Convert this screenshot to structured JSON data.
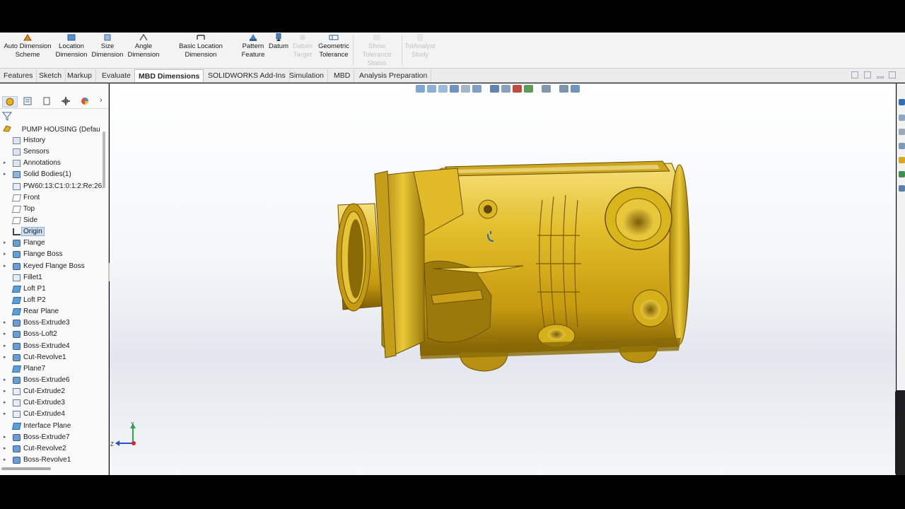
{
  "ribbon": {
    "buttons": [
      {
        "label": "Auto Dimension Scheme",
        "icon": "auto-dimension-icon",
        "enabled": true
      },
      {
        "label": "Location Dimension",
        "icon": "location-dimension-icon",
        "enabled": true
      },
      {
        "label": "Size Dimension",
        "icon": "size-dimension-icon",
        "enabled": true
      },
      {
        "label": "Angle Dimension",
        "icon": "angle-dimension-icon",
        "enabled": true
      },
      {
        "label": "Basic Location Dimension",
        "icon": "basic-location-dimension-icon",
        "enabled": true
      },
      {
        "label": "Pattern Feature",
        "icon": "pattern-feature-icon",
        "enabled": true
      },
      {
        "label": "Datum",
        "icon": "datum-icon",
        "enabled": true
      },
      {
        "label": "Datum Target",
        "icon": "datum-target-icon",
        "enabled": false
      },
      {
        "label": "Geometric Tolerance",
        "icon": "geometric-tolerance-icon",
        "enabled": true
      },
      {
        "label": "Show Tolerance Status",
        "icon": "tolerance-status-icon",
        "enabled": false
      },
      {
        "label": "TolAnalyst Study",
        "icon": "tolanalyst-icon",
        "enabled": false
      }
    ]
  },
  "tabs": [
    {
      "label": "Features",
      "active": false
    },
    {
      "label": "Sketch",
      "active": false
    },
    {
      "label": "Markup",
      "active": false
    },
    {
      "label": "Evaluate",
      "active": false
    },
    {
      "label": "MBD Dimensions",
      "active": true
    },
    {
      "label": "SOLIDWORKS Add-Ins",
      "active": false
    },
    {
      "label": "Simulation",
      "active": false
    },
    {
      "label": "MBD",
      "active": false
    },
    {
      "label": "Analysis Preparation",
      "active": false
    }
  ],
  "feature_tree": {
    "root": "PUMP HOUSING (Defau",
    "items": [
      {
        "label": "History",
        "icon": "folder",
        "expandable": false
      },
      {
        "label": "Sensors",
        "icon": "folder",
        "expandable": false
      },
      {
        "label": "Annotations",
        "icon": "folder",
        "expandable": true
      },
      {
        "label": "Solid Bodies(1)",
        "icon": "body",
        "expandable": true
      },
      {
        "label": "PW60:13:C1:0:1:2:Re:26:",
        "icon": "cut",
        "expandable": false
      },
      {
        "label": "Front",
        "icon": "plane-outline",
        "expandable": false
      },
      {
        "label": "Top",
        "icon": "plane-outline",
        "expandable": false
      },
      {
        "label": "Side",
        "icon": "plane-outline",
        "expandable": false
      },
      {
        "label": "Origin",
        "icon": "origin",
        "expandable": false,
        "selected": true
      },
      {
        "label": "Flange",
        "icon": "feature",
        "expandable": true
      },
      {
        "label": "Flange Boss",
        "icon": "feature",
        "expandable": true
      },
      {
        "label": "Keyed Flange Boss",
        "icon": "feature",
        "expandable": true
      },
      {
        "label": "Fillet1",
        "icon": "cut",
        "expandable": false
      },
      {
        "label": "Loft P1",
        "icon": "plane",
        "expandable": false
      },
      {
        "label": "Loft P2",
        "icon": "plane",
        "expandable": false
      },
      {
        "label": "Rear Plane",
        "icon": "plane",
        "expandable": false
      },
      {
        "label": "Boss-Extrude3",
        "icon": "feature",
        "expandable": true
      },
      {
        "label": "Boss-Loft2",
        "icon": "feature",
        "expandable": true
      },
      {
        "label": "Boss-Extrude4",
        "icon": "feature",
        "expandable": true
      },
      {
        "label": "Cut-Revolve1",
        "icon": "feature",
        "expandable": true
      },
      {
        "label": "Plane7",
        "icon": "plane",
        "expandable": false
      },
      {
        "label": "Boss-Extrude6",
        "icon": "feature",
        "expandable": true
      },
      {
        "label": "Cut-Extrude2",
        "icon": "cut",
        "expandable": true
      },
      {
        "label": "Cut-Extrude3",
        "icon": "cut",
        "expandable": true
      },
      {
        "label": "Cut-Extrude4",
        "icon": "cut",
        "expandable": true
      },
      {
        "label": "Interface Plane",
        "icon": "plane",
        "expandable": false
      },
      {
        "label": "Boss-Extrude7",
        "icon": "feature",
        "expandable": true
      },
      {
        "label": "Cut-Revolve2",
        "icon": "feature",
        "expandable": true
      },
      {
        "label": "Boss-Revolve1",
        "icon": "feature",
        "expandable": true
      }
    ]
  },
  "triad": {
    "z_label": "Z",
    "y_label": "Y"
  },
  "colors": {
    "part": "#d9b51c",
    "part_shadow": "#8a6a06",
    "part_highlight": "#f7e27a",
    "selection": "#c9dcf2"
  }
}
